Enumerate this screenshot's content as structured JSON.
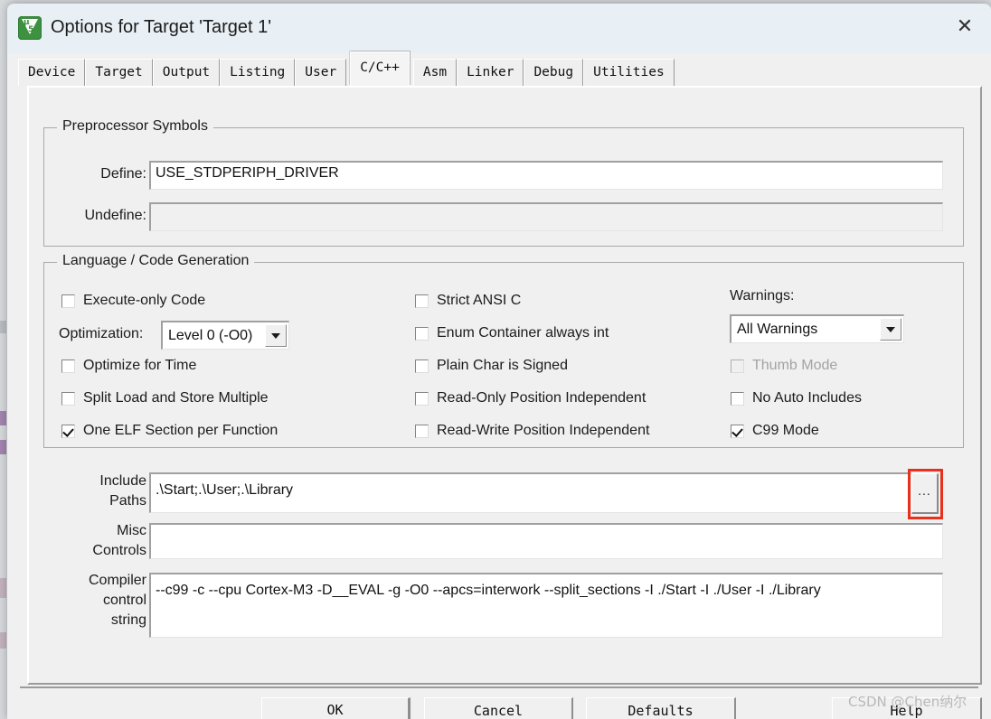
{
  "window": {
    "title": "Options for Target 'Target 1'",
    "icon": "uvision5-icon",
    "close_label": "✕"
  },
  "tabs": [
    {
      "label": "Device",
      "active": false
    },
    {
      "label": "Target",
      "active": false
    },
    {
      "label": "Output",
      "active": false
    },
    {
      "label": "Listing",
      "active": false
    },
    {
      "label": "User",
      "active": false
    },
    {
      "label": "C/C++",
      "active": true
    },
    {
      "label": "Asm",
      "active": false
    },
    {
      "label": "Linker",
      "active": false
    },
    {
      "label": "Debug",
      "active": false
    },
    {
      "label": "Utilities",
      "active": false
    }
  ],
  "preprocessor": {
    "group_title": "Preprocessor Symbols",
    "define_label": "Define:",
    "define_value": "USE_STDPERIPH_DRIVER",
    "undefine_label": "Undefine:",
    "undefine_value": ""
  },
  "language": {
    "group_title": "Language / Code Generation",
    "left_column": [
      {
        "label": "Execute-only Code",
        "checked": false,
        "disabled": false
      },
      {
        "label": "Optimize for Time",
        "checked": false,
        "disabled": false
      },
      {
        "label": "Split Load and Store Multiple",
        "checked": false,
        "disabled": false
      },
      {
        "label": "One ELF Section per Function",
        "checked": true,
        "disabled": false
      }
    ],
    "optimization_label": "Optimization:",
    "optimization_value": "Level 0 (-O0)",
    "middle_column": [
      {
        "label": "Strict ANSI C",
        "checked": false,
        "disabled": false
      },
      {
        "label": "Enum Container always int",
        "checked": false,
        "disabled": false
      },
      {
        "label": "Plain Char is Signed",
        "checked": false,
        "disabled": false
      },
      {
        "label": "Read-Only Position Independent",
        "checked": false,
        "disabled": false
      },
      {
        "label": "Read-Write Position Independent",
        "checked": false,
        "disabled": false
      }
    ],
    "warnings_label": "Warnings:",
    "warnings_value": "All Warnings",
    "right_column": [
      {
        "label": "Thumb Mode",
        "checked": false,
        "disabled": true
      },
      {
        "label": "No Auto Includes",
        "checked": false,
        "disabled": false
      },
      {
        "label": "C99 Mode",
        "checked": true,
        "disabled": false
      }
    ]
  },
  "paths": {
    "include_label": "Include\nPaths",
    "include_value": ".\\Start;.\\User;.\\Library",
    "browse_label": "...",
    "misc_label": "Misc\nControls",
    "misc_value": "",
    "compiler_label": "Compiler\ncontrol\nstring",
    "compiler_value": "--c99 -c --cpu Cortex-M3 -D__EVAL -g -O0 --apcs=interwork --split_sections -I ./Start -I ./User -I ./Library"
  },
  "buttons": {
    "ok": "OK",
    "cancel": "Cancel",
    "defaults": "Defaults",
    "help": "Help"
  },
  "watermark": "CSDN @Chen纳尔",
  "colors": {
    "highlight": "#e8301c",
    "titlebar": "#e9f0f5",
    "dialog_bg": "#f0f0f0",
    "icon_green": "#3d9140"
  }
}
